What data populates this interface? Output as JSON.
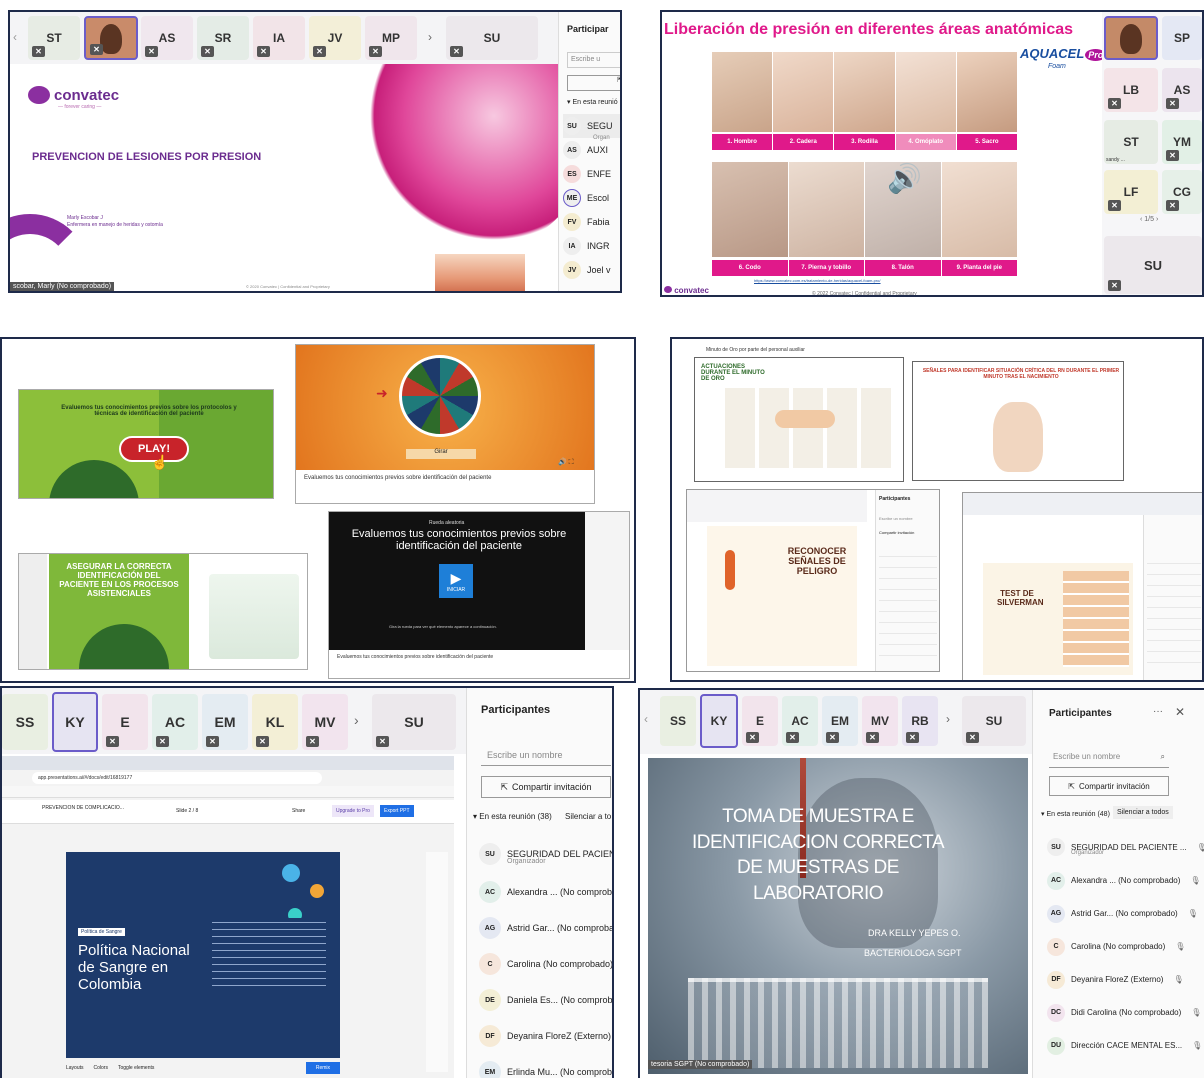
{
  "panel1": {
    "tiles": [
      "ST",
      "AS",
      "SR",
      "IA",
      "JV",
      "MP"
    ],
    "extra_tile": "SU",
    "participants_title": "Participar",
    "search_placeholder": "Escribe u",
    "section": "En esta reunió",
    "rows": [
      {
        "init": "SU",
        "name": "SEGU",
        "sub": "Organ"
      },
      {
        "init": "AS",
        "name": "AUXI"
      },
      {
        "init": "ES",
        "name": "ENFE"
      },
      {
        "init": "ME",
        "name": "Escol"
      },
      {
        "init": "FV",
        "name": "Fabia"
      },
      {
        "init": "IA",
        "name": "INGR"
      },
      {
        "init": "JV",
        "name": "Joel v"
      }
    ],
    "logo": "convatec",
    "logo_tagline": "— forever caring —",
    "slide_title": "PREVENCION DE LESIONES POR PRESION",
    "presenter_line1": "Marly Escobar J",
    "presenter_line2": "Enfermera en manejo de heridas y ostomía",
    "footer": "© 2020 Convatec | Confidential and Proprietary",
    "caption": "scobar, Marly (No comprobado)"
  },
  "panel2": {
    "title": "Liberación de presión en diferentes áreas anatómicas",
    "brand": "AQUACEL",
    "brand_sup": "Pro",
    "brand_sub": "Foam",
    "labels_top": [
      "1. Hombro",
      "2. Cadera",
      "3. Rodilla",
      "4. Omóplato",
      "5. Sacro"
    ],
    "labels_bottom": [
      "6. Codo",
      "7. Pierna y tobillo",
      "8. Talón",
      "9. Planta del pie"
    ],
    "url": "https://www.convatec.com.es/tratamiento-de-heridas/aquacel-foam-pro/",
    "footer": "© 2022 Convatec | Confidential and Proprietary",
    "logo": "convatec",
    "tiles": [
      "SP",
      "LB",
      "AS",
      "ST",
      "YM",
      "LF",
      "CG"
    ],
    "tile_caption": "sandy ...",
    "pager": "1/5",
    "big_tile": "SU"
  },
  "panel3": {
    "card1_text": "Evaluemos tus conocimientos previos sobre los protocolos y técnicas de identificación del paciente",
    "play": "PLAY!",
    "wheel_button": "Girar",
    "wheel_caption": "Evaluemos tus conocimientos previos sobre identificación del paciente",
    "card3_text": "ASEGURAR LA CORRECTA IDENTIFICACIÓN DEL PACIENTE EN LOS PROCESOS ASISTENCIALES",
    "video_small": "Rueda aleatoria",
    "video_title": "Evaluemos tus conocimientos previos sobre identificación del paciente",
    "video_button": "INICIAR",
    "video_hint": "Gira la rueda para ver qué elemento aparece a continuación.",
    "video_caption": "Evaluemos tus conocimientos previos sobre identificación del paciente"
  },
  "panel4": {
    "top_caption": "Minuto de Oro por parte del personal auxiliar",
    "card1_title": "ACTUACIONES DURANTE EL MINUTO DE ORO",
    "card2_title": "SEÑALES PARA IDENTIFICAR SITUACIÓN CRÍTICA DEL RN DURANTE EL PRIMER MINUTO TRAS EL NACIMIENTO",
    "shot1_title": "RECONOCER SEÑALES DE PELIGRO",
    "shot2_title": "TEST DE SILVERMAN",
    "participants": "Participantes",
    "search": "Escribe un nombre",
    "share": "Compartir invitación"
  },
  "panel5": {
    "tiles": [
      "SS",
      "KY",
      "E",
      "AC",
      "EM",
      "KL",
      "MV"
    ],
    "extra_tile": "SU",
    "url": "app.presentations.ai/#/docs/edit/16819177",
    "doc_name": "PREVENCION DE COMPLICACIO...",
    "slide_indicator": "Slide 2 / 8",
    "share": "Share",
    "upgrade": "Upgrade to Pro",
    "export": "Export PPT",
    "slide_tag": "Política de Sangre",
    "slide_title": "Política Nacional de Sangre en Colombia",
    "bottom_btns": [
      "Layouts",
      "Colors",
      "Toggle elements"
    ],
    "remix": "Remix",
    "participants_title": "Participantes",
    "search_placeholder": "Escribe un nombre",
    "invite": "Compartir invitación",
    "section": "En esta reunión (38)",
    "mute": "Silenciar a to",
    "rows": [
      {
        "init": "SU",
        "name": "SEGURIDAD DEL PACIENTE ...",
        "sub": "Organizador"
      },
      {
        "init": "AC",
        "name": "Alexandra ... (No comprobadc"
      },
      {
        "init": "AG",
        "name": "Astrid Gar... (No comprobadc"
      },
      {
        "init": "C",
        "name": "Carolina (No comprobado)"
      },
      {
        "init": "DE",
        "name": "Daniela Es... (No comprobadc"
      },
      {
        "init": "DF",
        "name": "Deyanira FloreZ (Externo)"
      },
      {
        "init": "EM",
        "name": "Erlinda Mu... (No comprobadc"
      }
    ]
  },
  "panel6": {
    "tiles": [
      "SS",
      "KY",
      "E",
      "AC",
      "EM",
      "MV",
      "RB"
    ],
    "extra_tile": "SU",
    "video_title": "TOMA DE MUESTRA E IDENTIFICACION CORRECTA DE MUESTRAS DE LABORATORIO",
    "author1": "DRA KELLY YEPES O.",
    "author2": "BACTERIOLOGA SGPT",
    "caption": "tesoria SGPT (No comprobado)",
    "participants_title": "Participantes",
    "search_placeholder": "Escribe un nombre",
    "invite": "Compartir invitación",
    "section": "En esta reunión (48)",
    "mute": "Silenciar a todos",
    "rows": [
      {
        "init": "SU",
        "name": "SEGURIDAD DEL PACIENTE ...",
        "sub": "Organizador"
      },
      {
        "init": "AC",
        "name": "Alexandra ... (No comprobado)"
      },
      {
        "init": "AG",
        "name": "Astrid Gar... (No comprobado)"
      },
      {
        "init": "C",
        "name": "Carolina (No comprobado)"
      },
      {
        "init": "DF",
        "name": "Deyanira FloreZ (Externo)"
      },
      {
        "init": "DC",
        "name": "Didi Carolina (No comprobado)"
      },
      {
        "init": "DU",
        "name": "Dirección CACE MENTAL ES..."
      }
    ]
  },
  "colors": {
    "convatec_purple": "#6b2c8f",
    "magenta": "#e0198a",
    "aquacel_blue": "#1a4fa0",
    "panel_border": "#1e2a4a",
    "green": "#6aa832",
    "dark_green": "#2e6b2a",
    "teams_blue": "#1f6fe5",
    "slide_navy": "#1d3a6b"
  }
}
